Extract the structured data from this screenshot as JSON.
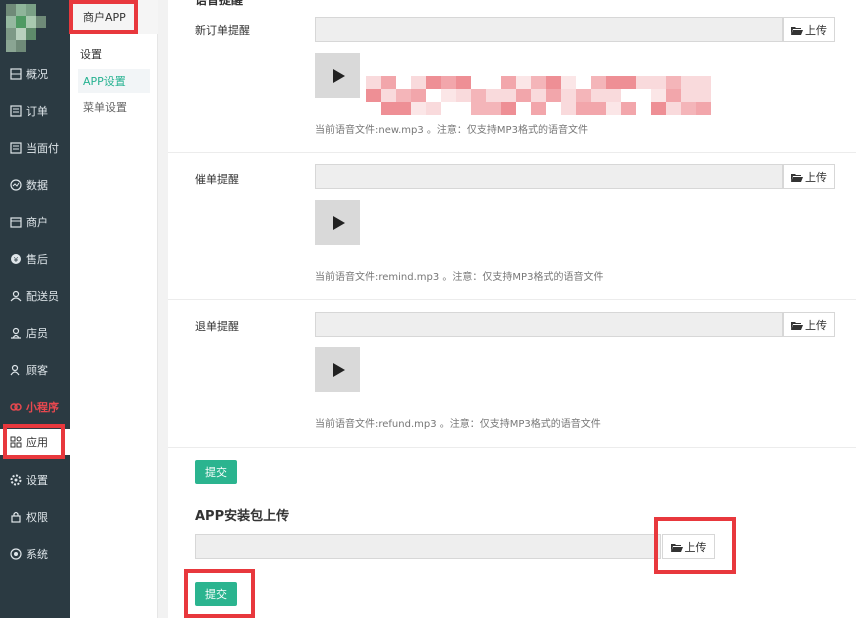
{
  "nav": {
    "items": [
      {
        "label": "概况",
        "icon": "overview-icon"
      },
      {
        "label": "订单",
        "icon": "order-icon"
      },
      {
        "label": "当面付",
        "icon": "face-pay-icon"
      },
      {
        "label": "数据",
        "icon": "data-icon"
      },
      {
        "label": "商户",
        "icon": "merchant-icon"
      },
      {
        "label": "售后",
        "icon": "after-sale-icon"
      },
      {
        "label": "配送员",
        "icon": "courier-icon"
      },
      {
        "label": "店员",
        "icon": "clerk-icon"
      },
      {
        "label": "顾客",
        "icon": "customer-icon"
      },
      {
        "label": "小程序",
        "icon": "mini-program-icon"
      },
      {
        "label": "应用",
        "icon": "apps-icon"
      },
      {
        "label": "设置",
        "icon": "settings-icon"
      },
      {
        "label": "权限",
        "icon": "lock-icon"
      },
      {
        "label": "系统",
        "icon": "system-icon"
      }
    ]
  },
  "subnav": {
    "title": "商户APP",
    "group_label": "设置",
    "links": [
      "APP设置",
      "菜单设置"
    ]
  },
  "partial_heading": "语音提醒",
  "upload_label": "上传",
  "submit_label": "提交",
  "voice_rows": [
    {
      "label": "新订单提醒",
      "hint": "当前语音文件:new.mp3 。注意：仅支持MP3格式的语音文件"
    },
    {
      "label": "催单提醒",
      "hint": "当前语音文件:remind.mp3 。注意：仅支持MP3格式的语音文件"
    },
    {
      "label": "退单提醒",
      "hint": "当前语音文件:refund.mp3 。注意：仅支持MP3格式的语音文件"
    }
  ],
  "apk_section": {
    "title": "APP安装包上传"
  },
  "colors": {
    "accent": "#2bb48f",
    "highlight": "#e8383d",
    "nav_bg": "#2b3a42"
  }
}
